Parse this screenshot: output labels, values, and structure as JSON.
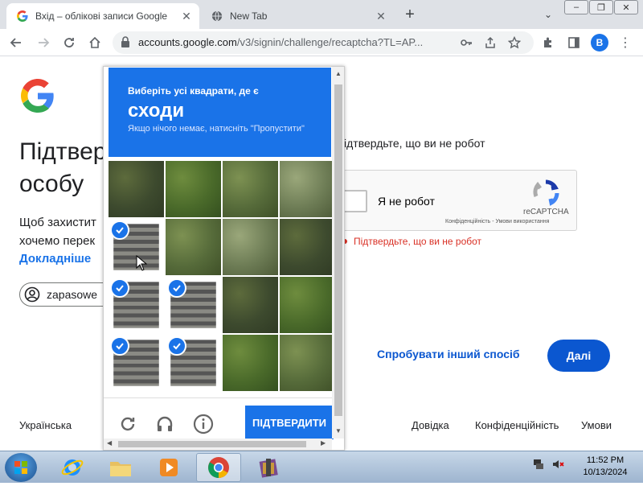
{
  "tabs": [
    {
      "title": "Вхід – облікові записи Google",
      "active": true
    },
    {
      "title": "New Tab",
      "active": false
    }
  ],
  "window_buttons": [
    "–",
    "❐",
    "✕"
  ],
  "address_bar": {
    "host": "accounts.google.com",
    "path": "/v3/signin/challenge/recaptcha?TL=AP..."
  },
  "profile_initial": "B",
  "page": {
    "title_line1": "Підтвер",
    "title_line2": "особу",
    "text_line1": "Щоб захистит",
    "text_line2": "хочемо перек",
    "learn_more": "Докладніше",
    "account_chip": "zapasowe",
    "right_text": "ідтвердьте, що ви не робот",
    "recaptcha": {
      "checkbox_label": "Я не робот",
      "brand": "reCAPTCHA",
      "terms": "Конфіденційність - Умови використання"
    },
    "error_text": "Підтвердьте, що ви не робот",
    "try_another": "Спробувати інший спосіб",
    "next_button": "Далі",
    "footer": {
      "language": "Українська",
      "help": "Довідка",
      "privacy": "Конфіденційність",
      "terms": "Умови"
    }
  },
  "challenge": {
    "instruction": "Виберіть усі квадрати, де є",
    "target": "сходи",
    "hint": "Якщо нічого немає, натисніть \"Пропустити\"",
    "verify_button": "ПІДТВЕРДИТИ",
    "tiles_selected": [
      [
        false,
        false,
        false,
        false
      ],
      [
        true,
        false,
        false,
        false
      ],
      [
        true,
        true,
        false,
        false
      ],
      [
        true,
        true,
        false,
        false
      ]
    ]
  },
  "taskbar": {
    "apps": [
      "ie-icon",
      "explorer-icon",
      "media-player-icon",
      "chrome-icon",
      "winrar-icon"
    ],
    "time": "11:52 PM",
    "date": "10/13/2024"
  },
  "colors": {
    "accent": "#1a73e8",
    "error": "#d93025"
  }
}
